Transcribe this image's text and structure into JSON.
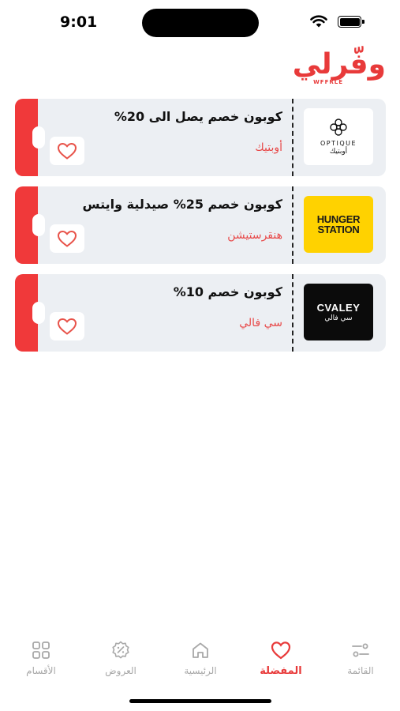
{
  "status_bar": {
    "time": "9:01"
  },
  "header": {
    "logo_text": "وفّرلي",
    "logo_subtext": "WFFRLE"
  },
  "coupons": [
    {
      "title": "كوبون خصم يصل الى 20%",
      "brand": "أوبتيك",
      "logo_text": "OPTIQUE",
      "logo_arabic": "أوبتيك"
    },
    {
      "title": "كوبون خصم 25% صيدلية وايتس",
      "brand": "هنقرستيشن",
      "logo_line1": "HUNGER",
      "logo_line2": "STATION"
    },
    {
      "title": "كوبون خصم 10%",
      "brand": "سي فالي",
      "logo_text": "CVALEY",
      "logo_arabic": "سي فالي"
    }
  ],
  "tabs": [
    {
      "label": "القائمة",
      "icon": "menu-sliders-icon"
    },
    {
      "label": "المفضلة",
      "icon": "heart-icon",
      "active": true
    },
    {
      "label": "الرئيسية",
      "icon": "home-icon"
    },
    {
      "label": "العروض",
      "icon": "discount-badge-icon"
    },
    {
      "label": "الأقسام",
      "icon": "grid-icon"
    }
  ],
  "colors": {
    "accent": "#e83a3a",
    "card_bg": "#eceff3",
    "inactive": "#a8a8a8",
    "hunger_yellow": "#ffd200"
  }
}
